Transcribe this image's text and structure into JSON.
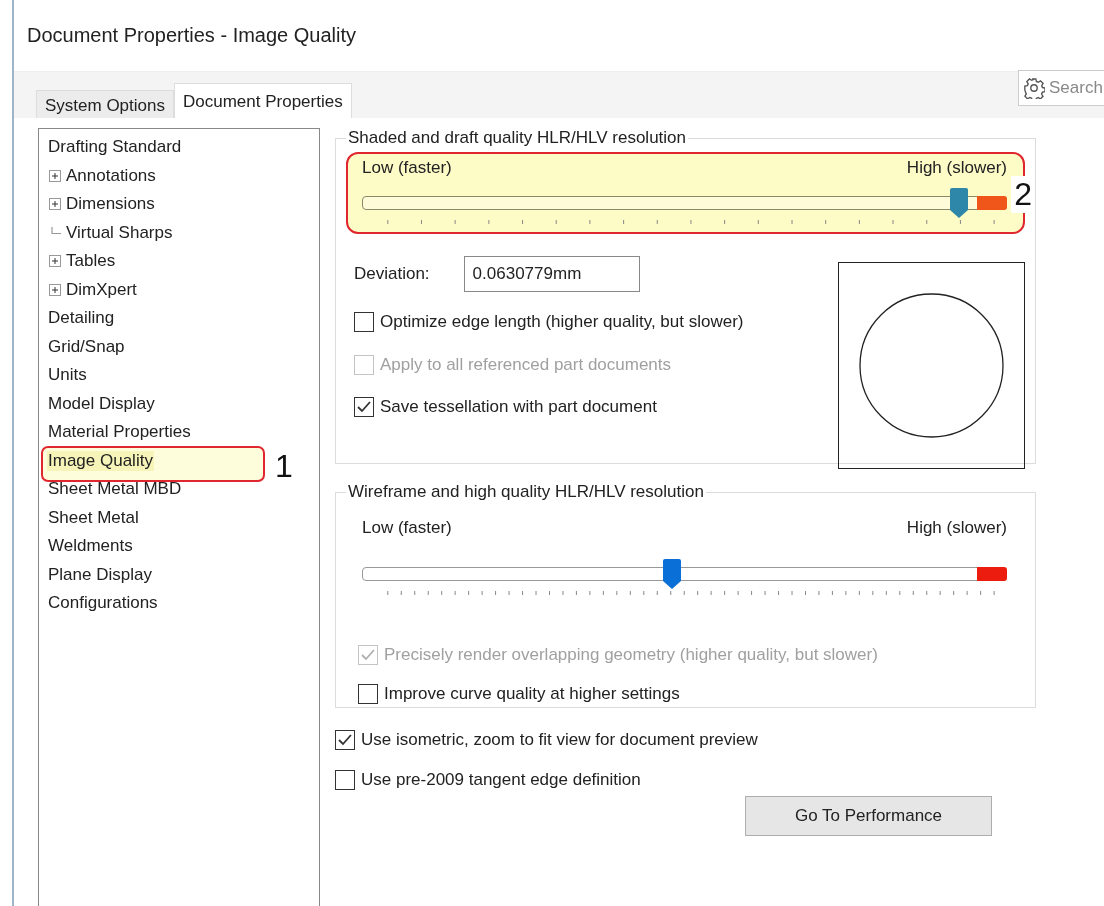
{
  "window": {
    "title": "Document Properties - Image Quality"
  },
  "tabs": [
    {
      "label": "System Options",
      "selected": false
    },
    {
      "label": "Document Properties",
      "selected": true
    }
  ],
  "search": {
    "placeholder": "Search"
  },
  "tree": [
    {
      "label": "Drafting Standard",
      "selected": false,
      "children": [
        {
          "label": "Annotations",
          "kind": "collapsed",
          "selected": false
        },
        {
          "label": "Dimensions",
          "kind": "collapsed",
          "selected": false
        },
        {
          "label": "Virtual Sharps",
          "kind": "plain",
          "selected": false
        },
        {
          "label": "Tables",
          "kind": "collapsed",
          "selected": false
        },
        {
          "label": "DimXpert",
          "kind": "collapsed",
          "selected": false
        }
      ]
    },
    {
      "label": "Detailing",
      "selected": false
    },
    {
      "label": "Grid/Snap",
      "selected": false
    },
    {
      "label": "Units",
      "selected": false
    },
    {
      "label": "Model Display",
      "selected": false
    },
    {
      "label": "Material Properties",
      "selected": false
    },
    {
      "label": "Image Quality",
      "selected": true,
      "callout": "1"
    },
    {
      "label": "Sheet Metal MBD",
      "selected": false
    },
    {
      "label": "Sheet Metal",
      "selected": false
    },
    {
      "label": "Weldments",
      "selected": false
    },
    {
      "label": "Plane Display",
      "selected": false
    },
    {
      "label": "Configurations",
      "selected": false
    }
  ],
  "groups": [
    {
      "title": "Shaded and draft quality HLR/HLV resolution",
      "slider": {
        "kind": "coarse",
        "low_label": "Low (faster)",
        "high_label": "High (slower)",
        "level": 0.925,
        "callout": "2"
      },
      "deviation": {
        "label": "Deviation:",
        "value": "0.0630779mm"
      },
      "checks": [
        {
          "label": "Optimize edge length (higher quality, but slower)",
          "checked": false,
          "disabled": false
        },
        {
          "label": "Apply to all referenced part documents",
          "checked": false,
          "disabled": true
        },
        {
          "label": "Save tessellation with part document",
          "checked": true,
          "disabled": false
        }
      ]
    },
    {
      "title": "Wireframe and high quality HLR/HLV resolution",
      "slider": {
        "kind": "fine",
        "low_label": "Low (faster)",
        "high_label": "High (slower)",
        "level": 0.48
      },
      "checks": [
        {
          "label": "Precisely render overlapping geometry (higher quality, but slower)",
          "checked": true,
          "disabled": true
        },
        {
          "label": "Improve curve quality at higher settings",
          "checked": false,
          "disabled": false
        }
      ]
    }
  ],
  "options": [
    {
      "label": "Use isometric, zoom to fit view for document preview",
      "checked": true,
      "disabled": false
    },
    {
      "label": "Use pre-2009 tangent edge definition",
      "checked": false,
      "disabled": false
    }
  ],
  "button": {
    "label": "Go To Performance"
  }
}
